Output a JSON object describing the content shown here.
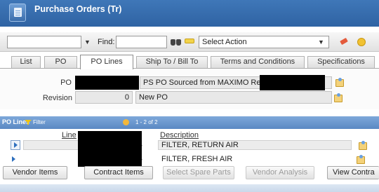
{
  "window": {
    "title": "Purchase Orders (Tr)"
  },
  "toolbar": {
    "find_label": "Find:",
    "find_value": "",
    "select_action": "Select Action"
  },
  "tabs": [
    {
      "label": "List"
    },
    {
      "label": "PO"
    },
    {
      "label": "PO Lines"
    },
    {
      "label": "Ship To / Bill To"
    },
    {
      "label": "Terms and Conditions"
    },
    {
      "label": "Specifications"
    }
  ],
  "header": {
    "po_label": "PO",
    "po_description": "PS PO Sourced from MAXIMO Requ",
    "revision_label": "Revision",
    "revision_value": "0",
    "status_value": "New PO"
  },
  "po_lines": {
    "title": "PO Lines",
    "filter_label": "Filter",
    "count_text": "1 - 2 of 2",
    "columns": {
      "line": "Line",
      "description": "Description"
    },
    "rows": [
      {
        "description": "FILTER, RETURN AIR"
      },
      {
        "description": "FILTER, FRESH AIR"
      }
    ]
  },
  "buttons": {
    "vendor_items": "Vendor Items",
    "contract_items": "Contract Items",
    "select_spare_parts": "Select Spare Parts",
    "vendor_analysis": "Vendor Analysis",
    "view_contracts": "View Contra"
  }
}
